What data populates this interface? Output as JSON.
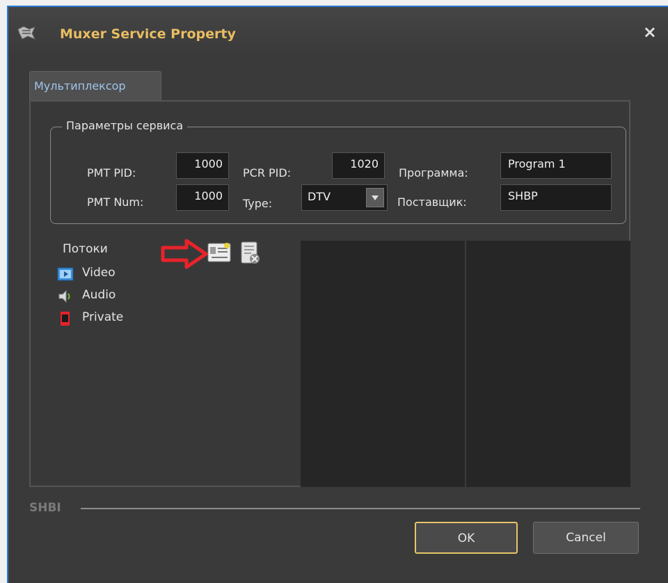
{
  "window": {
    "title": "Muxer Service Property",
    "close_label": "×"
  },
  "tabs": [
    {
      "label": "Мультиплексор"
    }
  ],
  "group": {
    "title": "Параметры сервиса",
    "pmt_pid": {
      "label": "PMT PID:",
      "value": "1000"
    },
    "pcr_pid": {
      "label": "PCR PID:",
      "value": "1020"
    },
    "program": {
      "label": "Программа:",
      "value": "Program 1"
    },
    "pmt_num": {
      "label": "PMT Num:",
      "value": "1000"
    },
    "type": {
      "label": "Type:",
      "value": "DTV"
    },
    "provider": {
      "label": "Поставщик:",
      "value": "SHBP"
    }
  },
  "streams": {
    "root_label": "Потоки",
    "items": [
      {
        "label": "Video",
        "icon": "video-icon"
      },
      {
        "label": "Audio",
        "icon": "audio-icon"
      },
      {
        "label": "Private",
        "icon": "private-icon"
      }
    ]
  },
  "toolbar": {
    "add_icon": "add-stream-icon",
    "delete_icon": "delete-stream-icon",
    "indicator_icon": "red-arrow-icon"
  },
  "footer": {
    "label": "SHBI",
    "ok_label": "OK",
    "cancel_label": "Cancel"
  },
  "colors": {
    "title": "#e9bd62",
    "accent_border": "#e6c568",
    "tab_text": "#9fc4ec",
    "indicator": "#e8232a"
  }
}
